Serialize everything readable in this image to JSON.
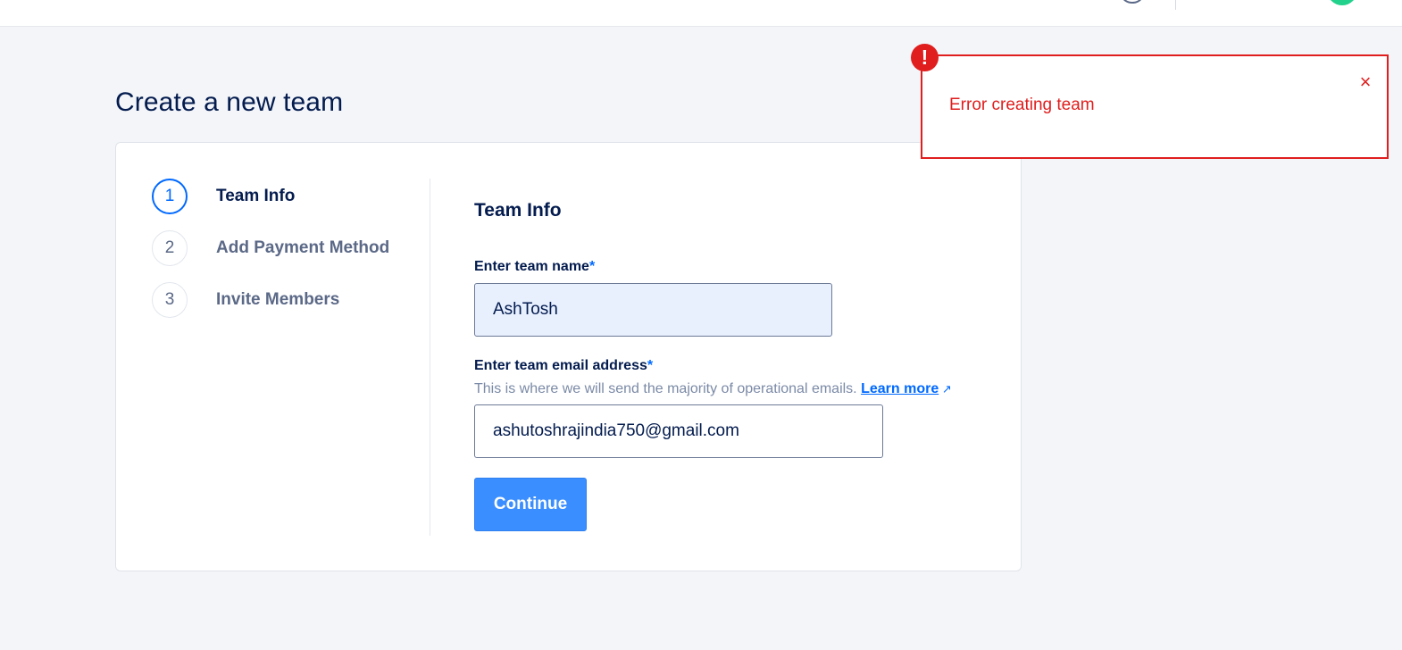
{
  "page": {
    "title": "Create a new team"
  },
  "steps": [
    {
      "number": "1",
      "label": "Team Info",
      "active": true
    },
    {
      "number": "2",
      "label": "Add Payment Method",
      "active": false
    },
    {
      "number": "3",
      "label": "Invite Members",
      "active": false
    }
  ],
  "form": {
    "section_title": "Team Info",
    "team_name_label": "Enter team name",
    "team_name_value": "AshTosh",
    "email_label": "Enter team email address",
    "email_help": "This is where we will send the majority of operational emails.",
    "learn_more": "Learn more",
    "email_value": "ashutoshrajindia750@gmail.com",
    "required_mark": "*",
    "continue_label": "Continue"
  },
  "toast": {
    "badge": "!",
    "message": "Error creating team",
    "close": "×"
  },
  "colors": {
    "accent": "#0069ff",
    "button": "#3b8eff",
    "error": "#e01e1e"
  }
}
